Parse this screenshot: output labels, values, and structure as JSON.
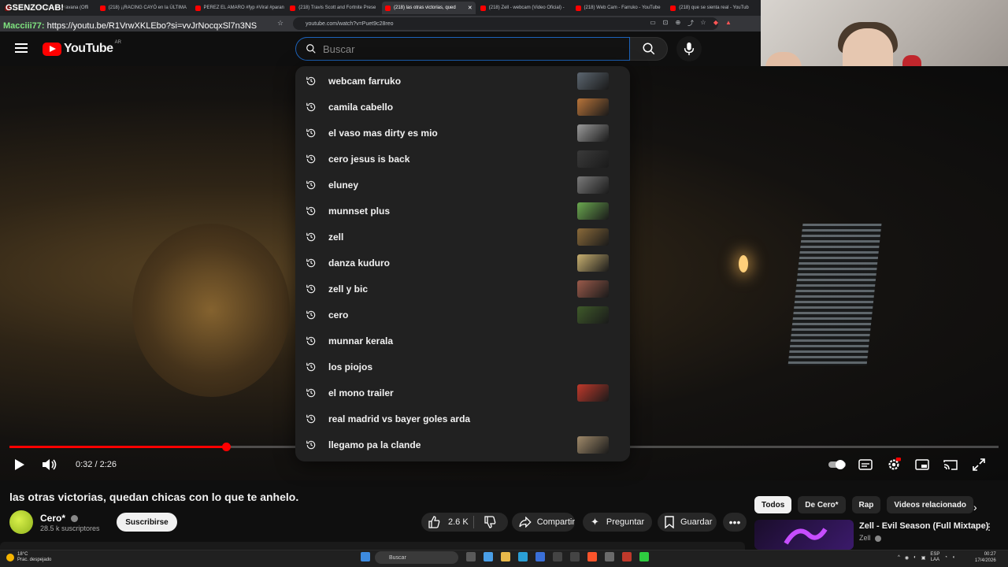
{
  "browser": {
    "tabs": [
      {
        "label": "(218) Camila Cabello - Havana (Offi",
        "active": false
      },
      {
        "label": "(218) ¡¡RACING CAYÓ en la ÚLTIMA",
        "active": false
      },
      {
        "label": "PEREZ EL AMARO #fyp #Viral #paran",
        "active": false
      },
      {
        "label": "(218) Travis Scott and Fortnite Prese",
        "active": false
      },
      {
        "label": "(218) las otras victorias, qued",
        "active": true
      },
      {
        "label": "(218) Zell - webcam (Video Oficial) -",
        "active": false
      },
      {
        "label": "(218) Web Cam - Farruko - YouTube",
        "active": false
      },
      {
        "label": "(218) que se sienta real - YouTub",
        "active": false
      }
    ],
    "url": "youtube.com/watch?v=Puet9c28reo",
    "stream_overlay": "GSENZOCAB!",
    "chat_user": "Macciii77:",
    "chat_message": "https://youtu.be/R1VrwXKLEbo?si=vvJrNocqxSl7n3NS"
  },
  "header": {
    "logo_text": "YouTube",
    "country_code": "AR",
    "search_placeholder": "Buscar"
  },
  "suggestions": [
    {
      "label": "webcam farruko",
      "thumb": "#5c6670"
    },
    {
      "label": "camila cabello",
      "thumb": "#b8743a"
    },
    {
      "label": "el vaso mas dirty es mio",
      "thumb": "#9a9a9a"
    },
    {
      "label": "cero jesus is back",
      "thumb": "#3a3a3a"
    },
    {
      "label": "eluney",
      "thumb": "#7a7a7a"
    },
    {
      "label": "munnset plus",
      "thumb": "#6aa84f"
    },
    {
      "label": "zell",
      "thumb": "#8a6a3a"
    },
    {
      "label": "danza kuduro",
      "thumb": "#c8b070"
    },
    {
      "label": "zell y bic",
      "thumb": "#9a5a4a"
    },
    {
      "label": "cero",
      "thumb": "#3f5a2a"
    },
    {
      "label": "munnar kerala",
      "thumb": ""
    },
    {
      "label": "los piojos",
      "thumb": ""
    },
    {
      "label": "el mono trailer",
      "thumb": "#c0392b"
    },
    {
      "label": "real madrid vs bayer goles arda",
      "thumb": ""
    },
    {
      "label": "llegamo pa la clande",
      "thumb": "#a08a6a"
    }
  ],
  "player": {
    "current_time": "0:32",
    "duration": "2:26",
    "time_display": "0:32 / 2:26",
    "progress": 0.219
  },
  "video": {
    "title": "las otras victorias, quedan chicas con lo que te anhelo.",
    "channel": "Cero*",
    "subscribers": "28.5 k suscriptores",
    "subscribe_label": "Suscribirse",
    "likes": "2.6 K",
    "share_label": "Compartir",
    "ask_label": "Preguntar",
    "save_label": "Guardar"
  },
  "chips": [
    "Todos",
    "De Cero*",
    "Rap",
    "Videos relacionado"
  ],
  "related": {
    "title": "Zell - Evil Season (Full Mixtape)",
    "channel": "Zell"
  },
  "taskbar": {
    "weather_temp": "18°C",
    "weather_desc": "Prac. despejado",
    "search_label": "Buscar",
    "lang": "ESP",
    "lang_sub": "LAA",
    "time": "00:27",
    "date": "17/4/2026"
  },
  "colors": {
    "accent": "#ff0000",
    "background": "#0f0f0f",
    "dropdown": "#212121"
  }
}
